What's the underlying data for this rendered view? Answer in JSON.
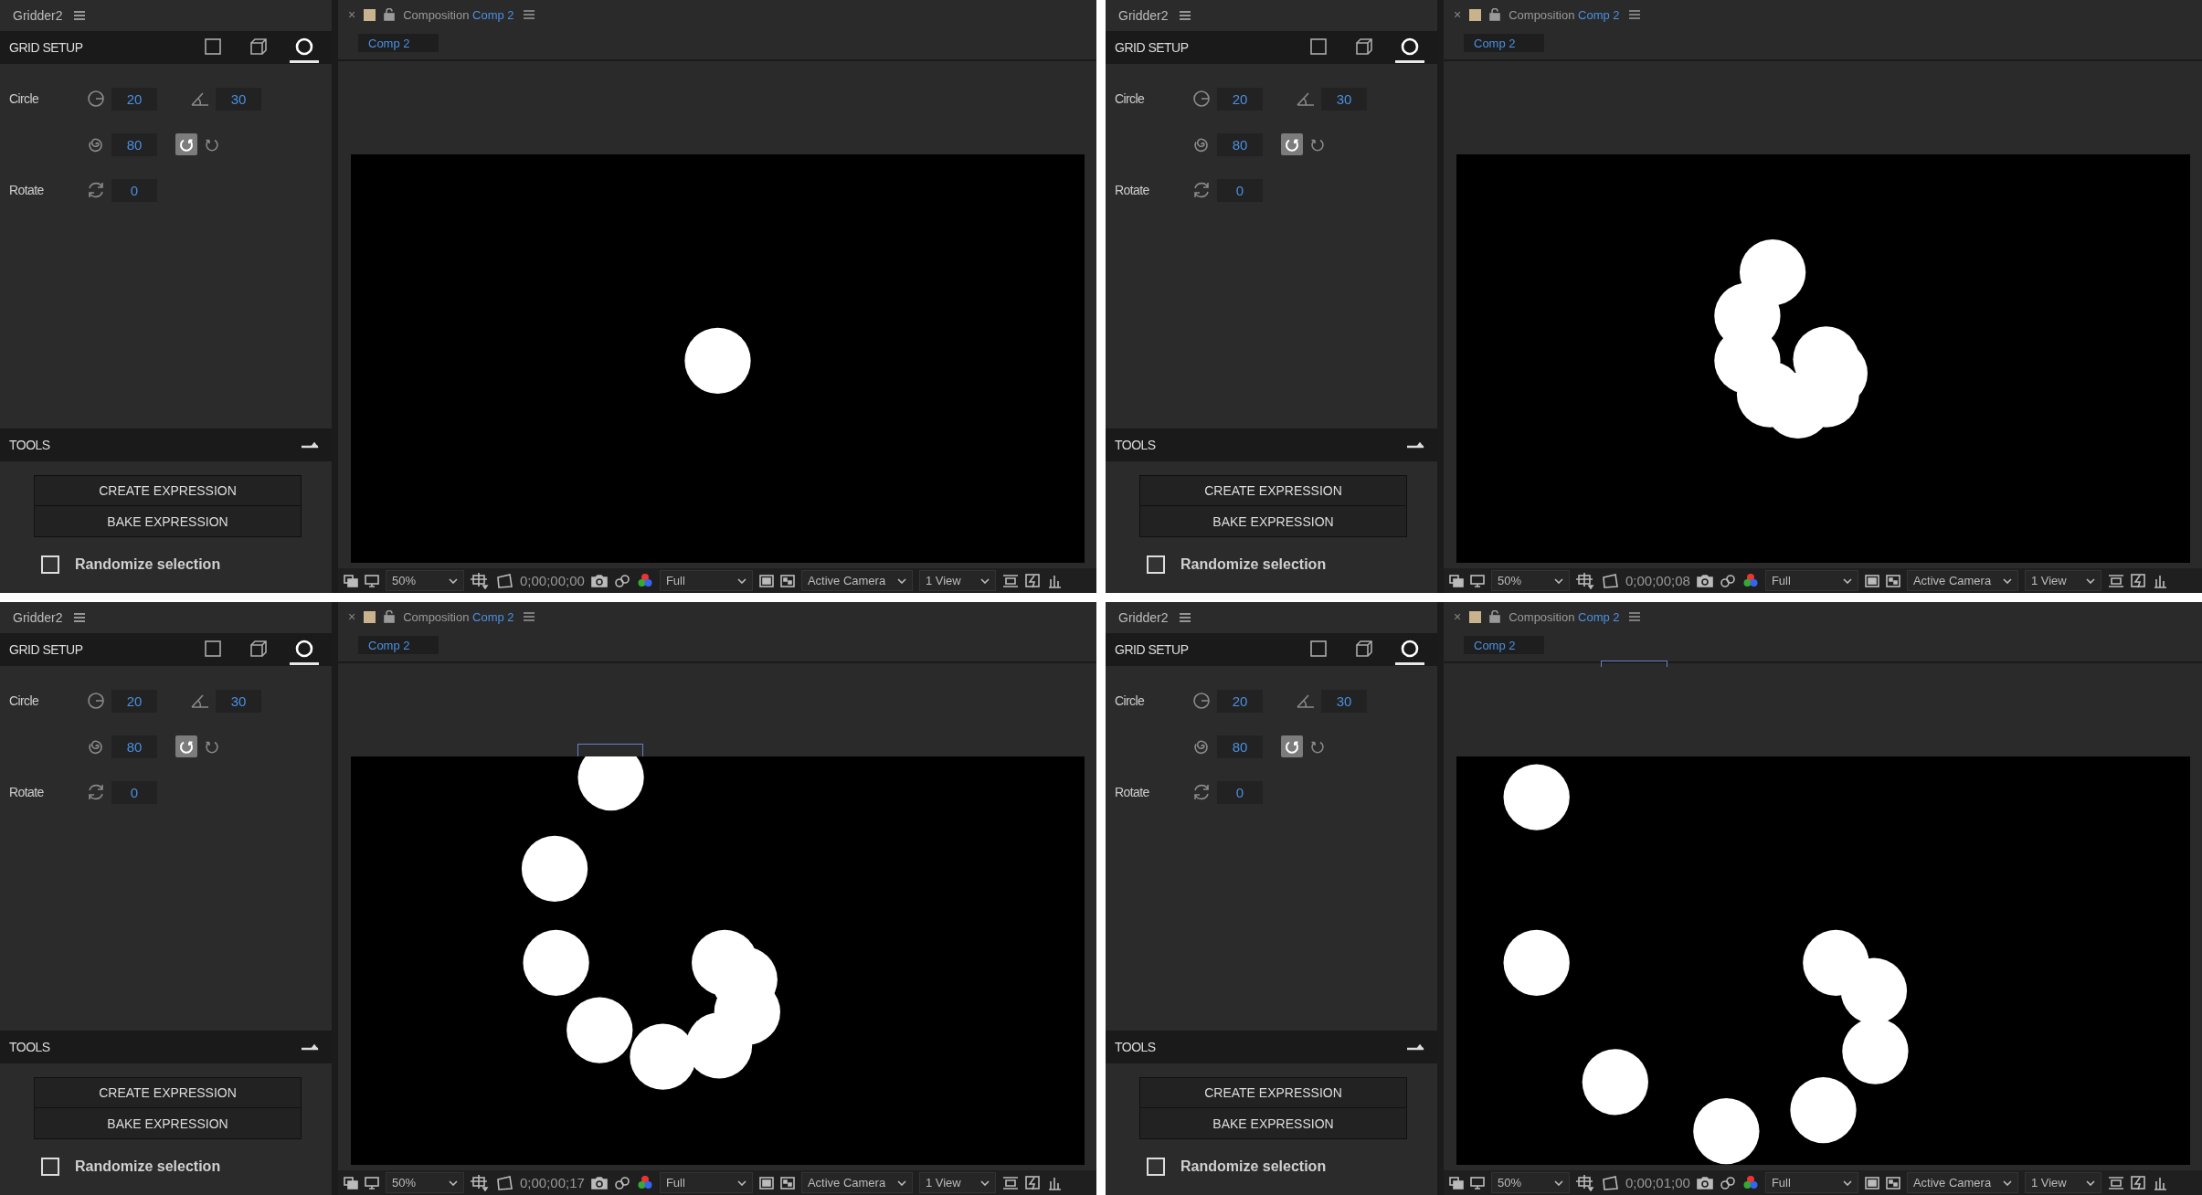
{
  "panels": [
    {
      "gridder": {
        "title": "Gridder2",
        "section": "GRID SETUP",
        "modes": [
          {
            "kind": "square",
            "selected": false
          },
          {
            "kind": "cube",
            "selected": false
          },
          {
            "kind": "circle",
            "selected": true
          }
        ],
        "circle_label": "Circle",
        "radius": "20",
        "angle": "30",
        "spiral": "80",
        "directions": [
          {
            "kind": "cw",
            "selected": true
          },
          {
            "kind": "ccw",
            "selected": false
          }
        ],
        "rotate_label": "Rotate",
        "rotate": "0",
        "tools_title": "TOOLS",
        "buttons": [
          "CREATE EXPRESSION",
          "BAKE EXPRESSION"
        ],
        "randomize": {
          "label": "Randomize selection",
          "checked": false
        }
      },
      "viewer": {
        "close": "×",
        "panel_label": "Composition",
        "comp_name": "Comp 2",
        "tab": "Comp 2",
        "zoom": "50%",
        "timecode": "0;00;00;00",
        "resolution": "Full",
        "camera": "Active Camera",
        "views": "1 View"
      }
    },
    {
      "gridder": {
        "title": "Gridder2",
        "section": "GRID SETUP",
        "modes": [
          {
            "kind": "square",
            "selected": false
          },
          {
            "kind": "cube",
            "selected": false
          },
          {
            "kind": "circle",
            "selected": true
          }
        ],
        "circle_label": "Circle",
        "radius": "20",
        "angle": "30",
        "spiral": "80",
        "directions": [
          {
            "kind": "cw",
            "selected": true
          },
          {
            "kind": "ccw",
            "selected": false
          }
        ],
        "rotate_label": "Rotate",
        "rotate": "0",
        "tools_title": "TOOLS",
        "buttons": [
          "CREATE EXPRESSION",
          "BAKE EXPRESSION"
        ],
        "randomize": {
          "label": "Randomize selection",
          "checked": false
        }
      },
      "viewer": {
        "close": "×",
        "panel_label": "Composition",
        "comp_name": "Comp 2",
        "tab": "Comp 2",
        "zoom": "50%",
        "timecode": "0;00;00;08",
        "resolution": "Full",
        "camera": "Active Camera",
        "views": "1 View"
      }
    },
    {
      "gridder": {
        "title": "Gridder2",
        "section": "GRID SETUP",
        "modes": [
          {
            "kind": "square",
            "selected": false
          },
          {
            "kind": "cube",
            "selected": false
          },
          {
            "kind": "circle",
            "selected": true
          }
        ],
        "circle_label": "Circle",
        "radius": "20",
        "angle": "30",
        "spiral": "80",
        "directions": [
          {
            "kind": "cw",
            "selected": true
          },
          {
            "kind": "ccw",
            "selected": false
          }
        ],
        "rotate_label": "Rotate",
        "rotate": "0",
        "tools_title": "TOOLS",
        "buttons": [
          "CREATE EXPRESSION",
          "BAKE EXPRESSION"
        ],
        "randomize": {
          "label": "Randomize selection",
          "checked": false
        }
      },
      "viewer": {
        "close": "×",
        "panel_label": "Composition",
        "comp_name": "Comp 2",
        "tab": "Comp 2",
        "zoom": "50%",
        "timecode": "0;00;00;17",
        "resolution": "Full",
        "camera": "Active Camera",
        "views": "1 View"
      }
    },
    {
      "gridder": {
        "title": "Gridder2",
        "section": "GRID SETUP",
        "modes": [
          {
            "kind": "square",
            "selected": false
          },
          {
            "kind": "cube",
            "selected": false
          },
          {
            "kind": "circle",
            "selected": true
          }
        ],
        "circle_label": "Circle",
        "radius": "20",
        "angle": "30",
        "spiral": "80",
        "directions": [
          {
            "kind": "cw",
            "selected": true
          },
          {
            "kind": "ccw",
            "selected": false
          }
        ],
        "rotate_label": "Rotate",
        "rotate": "0",
        "tools_title": "TOOLS",
        "buttons": [
          "CREATE EXPRESSION",
          "BAKE EXPRESSION"
        ],
        "randomize": {
          "label": "Randomize selection",
          "checked": false
        }
      },
      "viewer": {
        "close": "×",
        "panel_label": "Composition",
        "comp_name": "Comp 2",
        "tab": "Comp 2",
        "zoom": "50%",
        "timecode": "0;00;01;00",
        "resolution": "Full",
        "camera": "Active Camera",
        "views": "1 View"
      }
    }
  ]
}
